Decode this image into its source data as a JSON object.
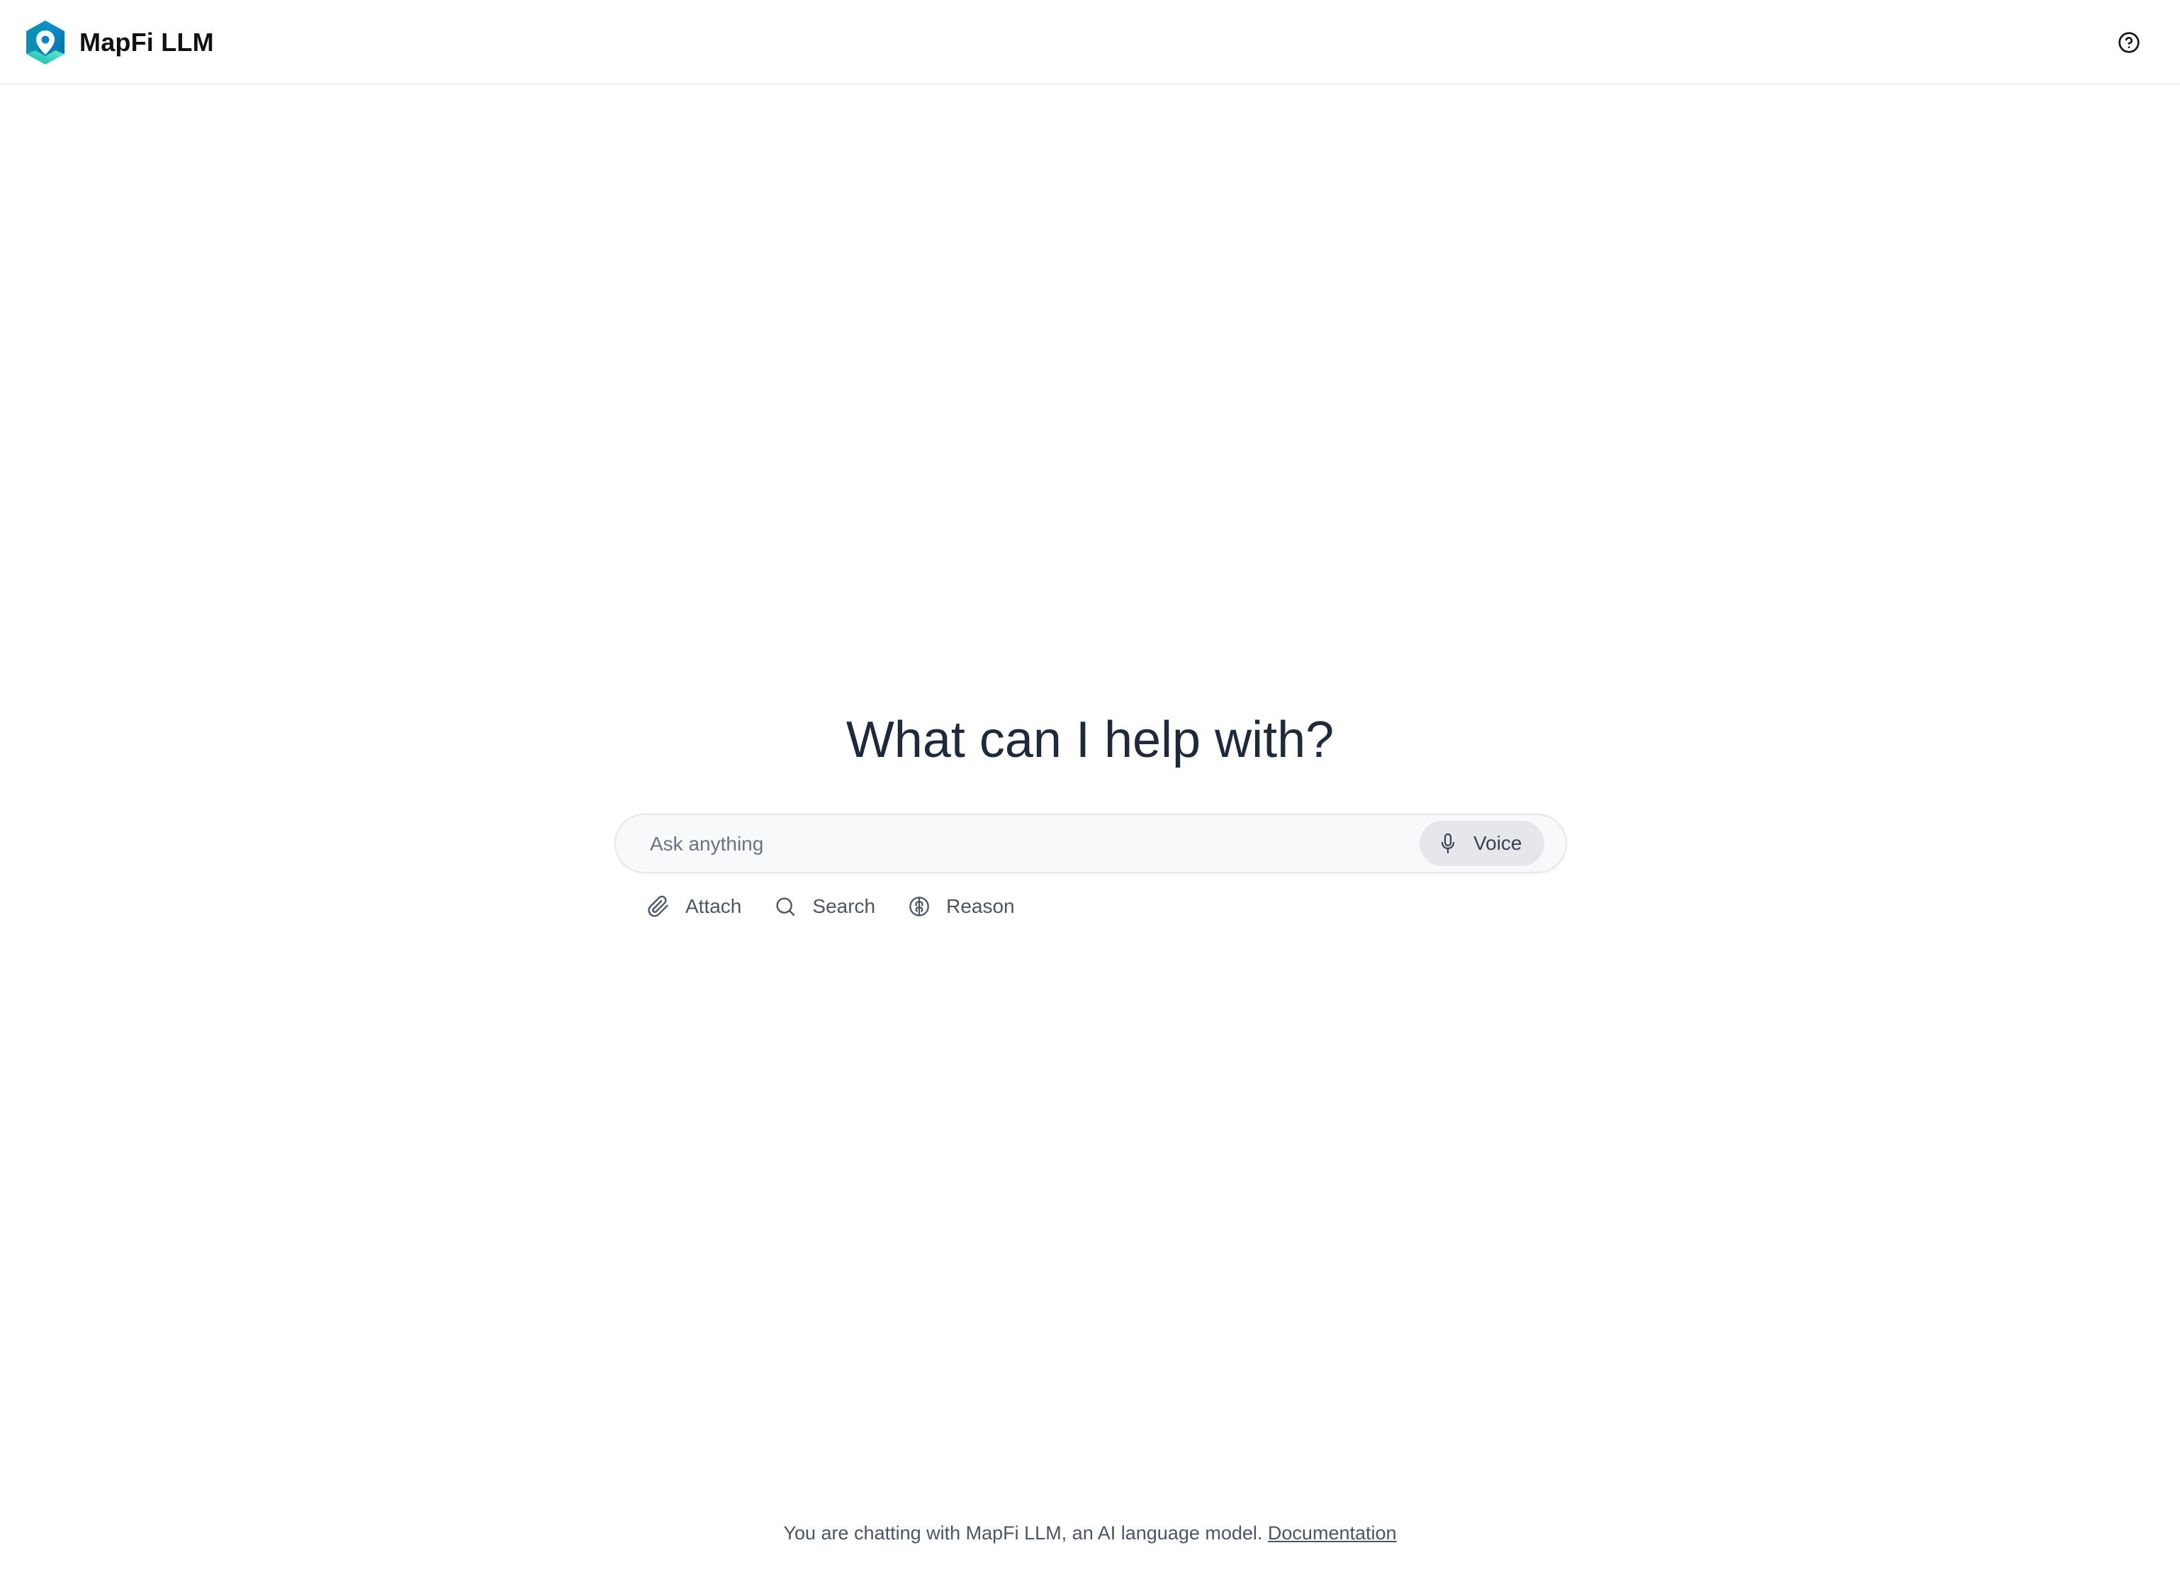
{
  "header": {
    "brand_name": "MapFi LLM",
    "logo_icon": "mapfi-hexagon-pin-logo",
    "help_icon": "help-circle-icon"
  },
  "main": {
    "title": "What can I help with?",
    "composer": {
      "placeholder": "Ask anything",
      "value": "",
      "voice_label": "Voice",
      "voice_icon": "microphone-icon"
    },
    "tools": [
      {
        "label": "Attach",
        "icon": "paperclip-icon"
      },
      {
        "label": "Search",
        "icon": "search-icon"
      },
      {
        "label": "Reason",
        "icon": "brain-icon"
      }
    ]
  },
  "footer": {
    "text": "You are chatting with MapFi LLM, an AI language model.",
    "link_label": "Documentation"
  },
  "colors": {
    "logo_teal": "#2dd4bf",
    "logo_blue": "#0284c7",
    "title": "#1e293b",
    "composer_bg": "#f8f9fa",
    "voice_bg": "#e5e7eb",
    "muted_text": "#4b5563"
  }
}
